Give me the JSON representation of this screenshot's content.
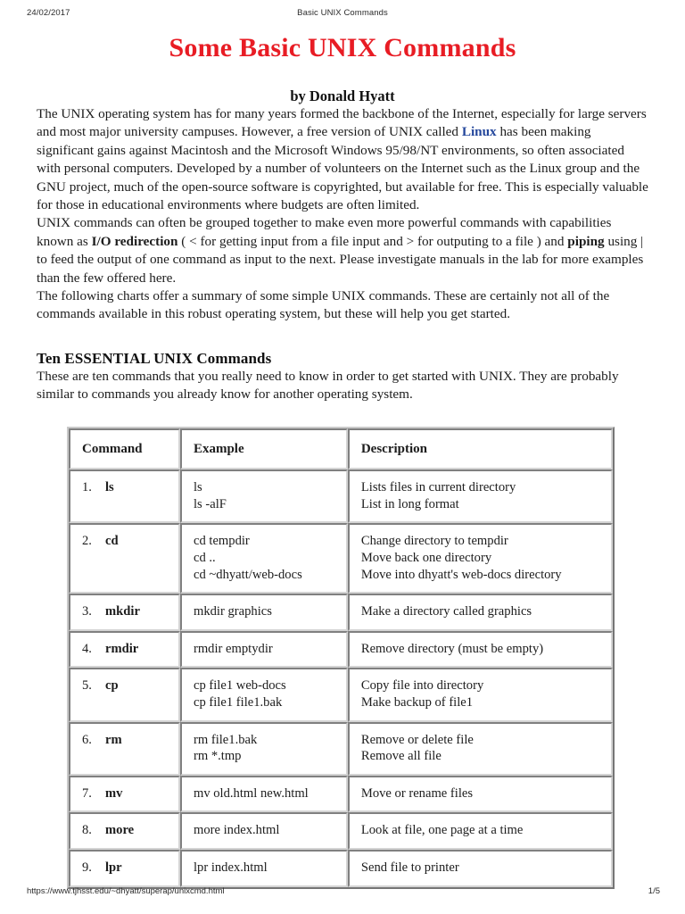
{
  "print_header": {
    "date": "24/02/2017",
    "title": "Basic UNIX Commands"
  },
  "document": {
    "title": "Some Basic UNIX Commands",
    "title_color": "#e81c24",
    "byline": "by Donald Hyatt",
    "paragraphs": {
      "p1_a": "The UNIX operating system has for many years formed the backbone of the Internet, especially for large servers and most major university campuses. However, a free version of UNIX called ",
      "p1_link": "Linux",
      "p1_b": " has been making significant gains against Macintosh and the Microsoft Windows 95/98/NT environments, so often associated with personal computers. Developed by a number of volunteers on the Internet such as the Linux group and the GNU project, much of the open-source software is copyrighted, but available for free. This is especially valuable for those in educational environments where budgets are often limited.",
      "p2_a": "UNIX commands can often be grouped together to make even more powerful commands with capabilities known as ",
      "p2_bold1": "I/O redirection",
      "p2_b": " ( < for getting input from a file input and > for outputing to a file ) and ",
      "p2_bold2": "piping",
      "p2_c": " using | to feed the output of one command as input to the next. Please investigate manuals in the lab for more examples than the few offered here.",
      "p3": "The following charts offer a summary of some simple UNIX commands. These are certainly not all of the commands available in this robust operating system, but these will help you get started.",
      "p4": "These are ten commands that you really need to know in order to get started with UNIX. They are probably similar to commands you already know for another operating system."
    },
    "section_heading": "Ten ESSENTIAL UNIX Commands",
    "link_color": "#24479c"
  },
  "command_table": {
    "headers": {
      "command": "Command",
      "example": "Example",
      "description": "Description"
    },
    "rows": [
      {
        "num": "1.",
        "command": "ls",
        "example_lines": [
          "ls",
          "ls -alF"
        ],
        "description_lines": [
          "Lists files in current directory",
          "List in long format"
        ]
      },
      {
        "num": "2.",
        "command": "cd",
        "example_lines": [
          "cd tempdir",
          "cd ..",
          "cd ~dhyatt/web-docs"
        ],
        "description_lines": [
          "Change directory to tempdir",
          "Move back one directory",
          "Move into dhyatt's web-docs directory"
        ]
      },
      {
        "num": "3.",
        "command": "mkdir",
        "example_lines": [
          "mkdir graphics"
        ],
        "description_lines": [
          "Make a directory called graphics"
        ]
      },
      {
        "num": "4.",
        "command": "rmdir",
        "example_lines": [
          "rmdir emptydir"
        ],
        "description_lines": [
          "Remove directory (must be empty)"
        ]
      },
      {
        "num": "5.",
        "command": "cp",
        "example_lines": [
          "cp file1 web-docs",
          "cp file1 file1.bak"
        ],
        "description_lines": [
          "Copy file into directory",
          "Make backup of file1"
        ]
      },
      {
        "num": "6.",
        "command": "rm",
        "example_lines": [
          "rm file1.bak",
          "rm *.tmp"
        ],
        "description_lines": [
          "Remove or delete file",
          "Remove all file"
        ]
      },
      {
        "num": "7.",
        "command": "mv",
        "example_lines": [
          "mv old.html new.html"
        ],
        "description_lines": [
          "Move or rename files"
        ]
      },
      {
        "num": "8.",
        "command": "more",
        "example_lines": [
          "more index.html"
        ],
        "description_lines": [
          "Look at file, one page at a time"
        ]
      },
      {
        "num": "9.",
        "command": "lpr",
        "example_lines": [
          "lpr index.html"
        ],
        "description_lines": [
          "Send file to printer"
        ]
      }
    ]
  },
  "print_footer": {
    "url": "https://www.tjhsst.edu/~dhyatt/superap/unixcmd.html",
    "page": "1/5"
  }
}
